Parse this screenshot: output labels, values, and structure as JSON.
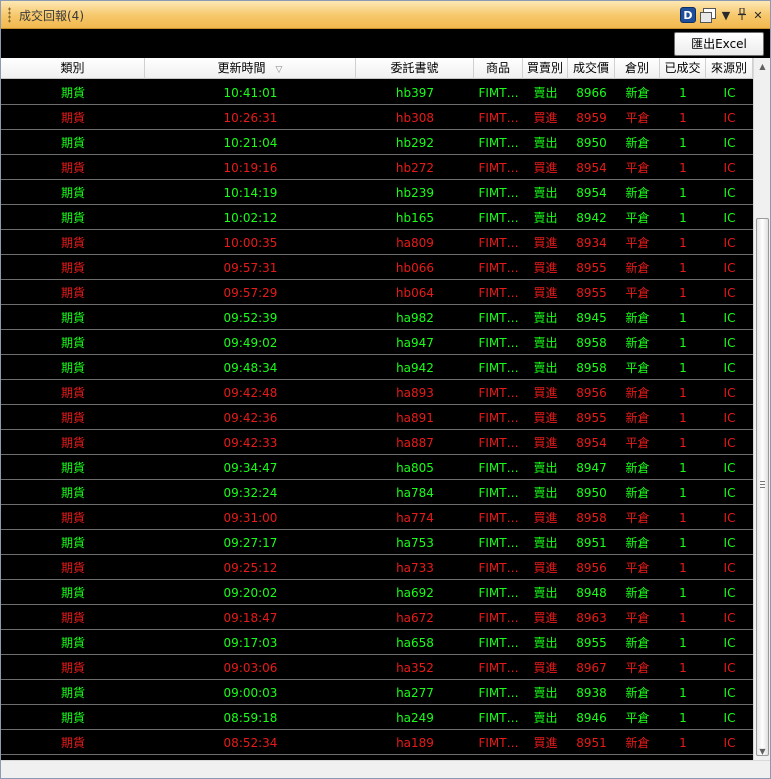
{
  "window": {
    "title": "成交回報(4)"
  },
  "titlebar_icons": [
    "d-badge-icon",
    "window-icon",
    "dropdown-icon",
    "pin-icon",
    "close-icon"
  ],
  "titlebar_glyphs": {
    "d": "D",
    "dropdown": "▼",
    "pin": "ᵖ",
    "close": "✕"
  },
  "toolbar": {
    "export_label": "匯出Excel"
  },
  "columns": [
    {
      "key": "type",
      "label": "類別"
    },
    {
      "key": "time",
      "label": "更新時間",
      "sorted": true,
      "sort_glyph": "▽"
    },
    {
      "key": "order_no",
      "label": "委託書號"
    },
    {
      "key": "product",
      "label": "商品"
    },
    {
      "key": "side",
      "label": "買賣別"
    },
    {
      "key": "price",
      "label": "成交價"
    },
    {
      "key": "position",
      "label": "倉別"
    },
    {
      "key": "filled",
      "label": "已成交"
    },
    {
      "key": "source",
      "label": "來源別"
    }
  ],
  "colors": {
    "sell": "#19ff19",
    "buy": "#e81a1a",
    "background": "#000000"
  },
  "rows": [
    {
      "type": "期貨",
      "time": "10:41:01",
      "order_no": "hb397",
      "product": "FIMT…",
      "side": "賣出",
      "price": "8966",
      "position": "新倉",
      "filled": "1",
      "source": "IC"
    },
    {
      "type": "期貨",
      "time": "10:26:31",
      "order_no": "hb308",
      "product": "FIMT…",
      "side": "買進",
      "price": "8959",
      "position": "平倉",
      "filled": "1",
      "source": "IC"
    },
    {
      "type": "期貨",
      "time": "10:21:04",
      "order_no": "hb292",
      "product": "FIMT…",
      "side": "賣出",
      "price": "8950",
      "position": "新倉",
      "filled": "1",
      "source": "IC"
    },
    {
      "type": "期貨",
      "time": "10:19:16",
      "order_no": "hb272",
      "product": "FIMT…",
      "side": "買進",
      "price": "8954",
      "position": "平倉",
      "filled": "1",
      "source": "IC"
    },
    {
      "type": "期貨",
      "time": "10:14:19",
      "order_no": "hb239",
      "product": "FIMT…",
      "side": "賣出",
      "price": "8954",
      "position": "新倉",
      "filled": "1",
      "source": "IC"
    },
    {
      "type": "期貨",
      "time": "10:02:12",
      "order_no": "hb165",
      "product": "FIMT…",
      "side": "賣出",
      "price": "8942",
      "position": "平倉",
      "filled": "1",
      "source": "IC"
    },
    {
      "type": "期貨",
      "time": "10:00:35",
      "order_no": "ha809",
      "product": "FIMT…",
      "side": "買進",
      "price": "8934",
      "position": "平倉",
      "filled": "1",
      "source": "IC"
    },
    {
      "type": "期貨",
      "time": "09:57:31",
      "order_no": "hb066",
      "product": "FIMT…",
      "side": "買進",
      "price": "8955",
      "position": "新倉",
      "filled": "1",
      "source": "IC"
    },
    {
      "type": "期貨",
      "time": "09:57:29",
      "order_no": "hb064",
      "product": "FIMT…",
      "side": "買進",
      "price": "8955",
      "position": "平倉",
      "filled": "1",
      "source": "IC"
    },
    {
      "type": "期貨",
      "time": "09:52:39",
      "order_no": "ha982",
      "product": "FIMT…",
      "side": "賣出",
      "price": "8945",
      "position": "新倉",
      "filled": "1",
      "source": "IC"
    },
    {
      "type": "期貨",
      "time": "09:49:02",
      "order_no": "ha947",
      "product": "FIMT…",
      "side": "賣出",
      "price": "8958",
      "position": "新倉",
      "filled": "1",
      "source": "IC"
    },
    {
      "type": "期貨",
      "time": "09:48:34",
      "order_no": "ha942",
      "product": "FIMT…",
      "side": "賣出",
      "price": "8958",
      "position": "平倉",
      "filled": "1",
      "source": "IC"
    },
    {
      "type": "期貨",
      "time": "09:42:48",
      "order_no": "ha893",
      "product": "FIMT…",
      "side": "買進",
      "price": "8956",
      "position": "新倉",
      "filled": "1",
      "source": "IC"
    },
    {
      "type": "期貨",
      "time": "09:42:36",
      "order_no": "ha891",
      "product": "FIMT…",
      "side": "買進",
      "price": "8955",
      "position": "新倉",
      "filled": "1",
      "source": "IC"
    },
    {
      "type": "期貨",
      "time": "09:42:33",
      "order_no": "ha887",
      "product": "FIMT…",
      "side": "買進",
      "price": "8954",
      "position": "平倉",
      "filled": "1",
      "source": "IC"
    },
    {
      "type": "期貨",
      "time": "09:34:47",
      "order_no": "ha805",
      "product": "FIMT…",
      "side": "賣出",
      "price": "8947",
      "position": "新倉",
      "filled": "1",
      "source": "IC"
    },
    {
      "type": "期貨",
      "time": "09:32:24",
      "order_no": "ha784",
      "product": "FIMT…",
      "side": "賣出",
      "price": "8950",
      "position": "新倉",
      "filled": "1",
      "source": "IC"
    },
    {
      "type": "期貨",
      "time": "09:31:00",
      "order_no": "ha774",
      "product": "FIMT…",
      "side": "買進",
      "price": "8958",
      "position": "平倉",
      "filled": "1",
      "source": "IC"
    },
    {
      "type": "期貨",
      "time": "09:27:17",
      "order_no": "ha753",
      "product": "FIMT…",
      "side": "賣出",
      "price": "8951",
      "position": "新倉",
      "filled": "1",
      "source": "IC"
    },
    {
      "type": "期貨",
      "time": "09:25:12",
      "order_no": "ha733",
      "product": "FIMT…",
      "side": "買進",
      "price": "8956",
      "position": "平倉",
      "filled": "1",
      "source": "IC"
    },
    {
      "type": "期貨",
      "time": "09:20:02",
      "order_no": "ha692",
      "product": "FIMT…",
      "side": "賣出",
      "price": "8948",
      "position": "新倉",
      "filled": "1",
      "source": "IC"
    },
    {
      "type": "期貨",
      "time": "09:18:47",
      "order_no": "ha672",
      "product": "FIMT…",
      "side": "買進",
      "price": "8963",
      "position": "平倉",
      "filled": "1",
      "source": "IC"
    },
    {
      "type": "期貨",
      "time": "09:17:03",
      "order_no": "ha658",
      "product": "FIMT…",
      "side": "賣出",
      "price": "8955",
      "position": "新倉",
      "filled": "1",
      "source": "IC"
    },
    {
      "type": "期貨",
      "time": "09:03:06",
      "order_no": "ha352",
      "product": "FIMT…",
      "side": "買進",
      "price": "8967",
      "position": "平倉",
      "filled": "1",
      "source": "IC"
    },
    {
      "type": "期貨",
      "time": "09:00:03",
      "order_no": "ha277",
      "product": "FIMT…",
      "side": "賣出",
      "price": "8938",
      "position": "新倉",
      "filled": "1",
      "source": "IC"
    },
    {
      "type": "期貨",
      "time": "08:59:18",
      "order_no": "ha249",
      "product": "FIMT…",
      "side": "賣出",
      "price": "8946",
      "position": "平倉",
      "filled": "1",
      "source": "IC"
    },
    {
      "type": "期貨",
      "time": "08:52:34",
      "order_no": "ha189",
      "product": "FIMT…",
      "side": "買進",
      "price": "8951",
      "position": "新倉",
      "filled": "1",
      "source": "IC"
    }
  ],
  "scrollbar": {
    "up_glyph": "▲",
    "down_glyph": "▼"
  }
}
